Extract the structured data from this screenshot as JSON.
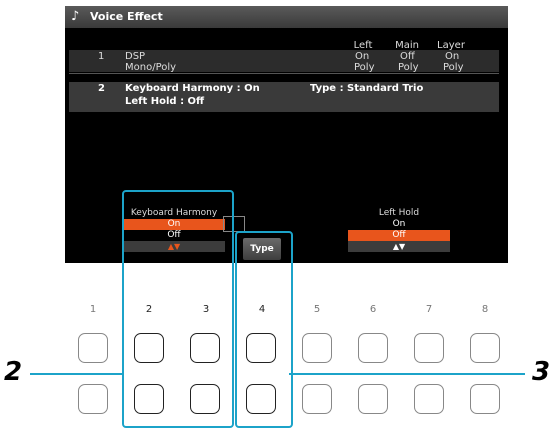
{
  "screen": {
    "title": "Voice Effect",
    "headers": [
      "Left",
      "Main",
      "Layer"
    ],
    "row1": {
      "num": "1",
      "label1": "DSP",
      "label2": "Mono/Poly",
      "dsp": [
        "On",
        "Off",
        "On"
      ],
      "mono": [
        "Poly",
        "Poly",
        "Poly"
      ]
    },
    "row2": {
      "num": "2",
      "kh_label": "Keyboard Harmony : On",
      "type_label": "Type : Standard Trio",
      "left_hold_label": "Left Hold : Off"
    },
    "kh_box": {
      "label": "Keyboard Harmony",
      "opt_on": "On",
      "opt_off": "Off",
      "arrows": "▲▼"
    },
    "lh_box": {
      "label": "Left Hold",
      "opt_on": "On",
      "opt_off": "Off",
      "arrows": "▲▼"
    },
    "type_button": "Type"
  },
  "button_numbers": [
    "1",
    "2",
    "3",
    "4",
    "5",
    "6",
    "7",
    "8"
  ],
  "callouts": {
    "left": "2",
    "right": "3"
  },
  "colors": {
    "highlight": "#1ca3c9",
    "selected": "#e8551c"
  }
}
